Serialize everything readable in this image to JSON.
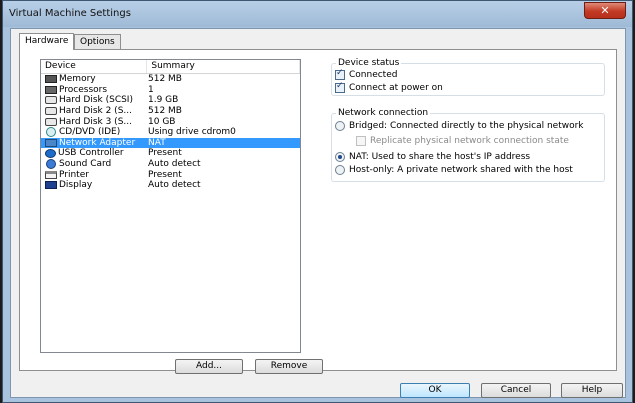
{
  "window": {
    "title": "Virtual Machine Settings",
    "close_glyph": "✕"
  },
  "tabs": [
    {
      "label": "Hardware",
      "active": true
    },
    {
      "label": "Options",
      "active": false
    }
  ],
  "device_list": {
    "headers": {
      "device": "Device",
      "summary": "Summary"
    },
    "rows": [
      {
        "device": "Memory",
        "summary": "512 MB",
        "icon": "memory-icon"
      },
      {
        "device": "Processors",
        "summary": "1",
        "icon": "processor-icon"
      },
      {
        "device": "Hard Disk (SCSI)",
        "summary": "1.9 GB",
        "icon": "hard-disk-icon"
      },
      {
        "device": "Hard Disk 2 (S...",
        "summary": "512 MB",
        "icon": "hard-disk-icon"
      },
      {
        "device": "Hard Disk 3 (S...",
        "summary": "10 GB",
        "icon": "hard-disk-icon"
      },
      {
        "device": "CD/DVD (IDE)",
        "summary": "Using drive cdrom0",
        "icon": "cd-dvd-icon"
      },
      {
        "device": "Network Adapter",
        "summary": "NAT",
        "icon": "network-adapter-icon",
        "selected": true
      },
      {
        "device": "USB Controller",
        "summary": "Present",
        "icon": "usb-icon"
      },
      {
        "device": "Sound Card",
        "summary": "Auto detect",
        "icon": "sound-card-icon"
      },
      {
        "device": "Printer",
        "summary": "Present",
        "icon": "printer-icon"
      },
      {
        "device": "Display",
        "summary": "Auto detect",
        "icon": "display-icon"
      }
    ]
  },
  "list_buttons": {
    "add": "Add...",
    "remove": "Remove"
  },
  "device_status": {
    "title": "Device status",
    "connected": {
      "label": "Connected",
      "checked": true
    },
    "connect_at_power_on": {
      "label": "Connect at power on",
      "checked": true
    }
  },
  "network_connection": {
    "title": "Network connection",
    "bridged": {
      "label": "Bridged: Connected directly to the physical network",
      "selected": false
    },
    "replicate": {
      "label": "Replicate physical network connection state",
      "checked": false,
      "enabled": false
    },
    "nat": {
      "label": "NAT: Used to share the host's IP address",
      "selected": true
    },
    "host_only": {
      "label": "Host-only: A private network shared with the host",
      "selected": false
    }
  },
  "footer": {
    "ok": "OK",
    "cancel": "Cancel",
    "help": "Help"
  },
  "colors": {
    "selection": "#3399ff",
    "title_bar": "#a9c3de",
    "close_button": "#c23a24"
  }
}
